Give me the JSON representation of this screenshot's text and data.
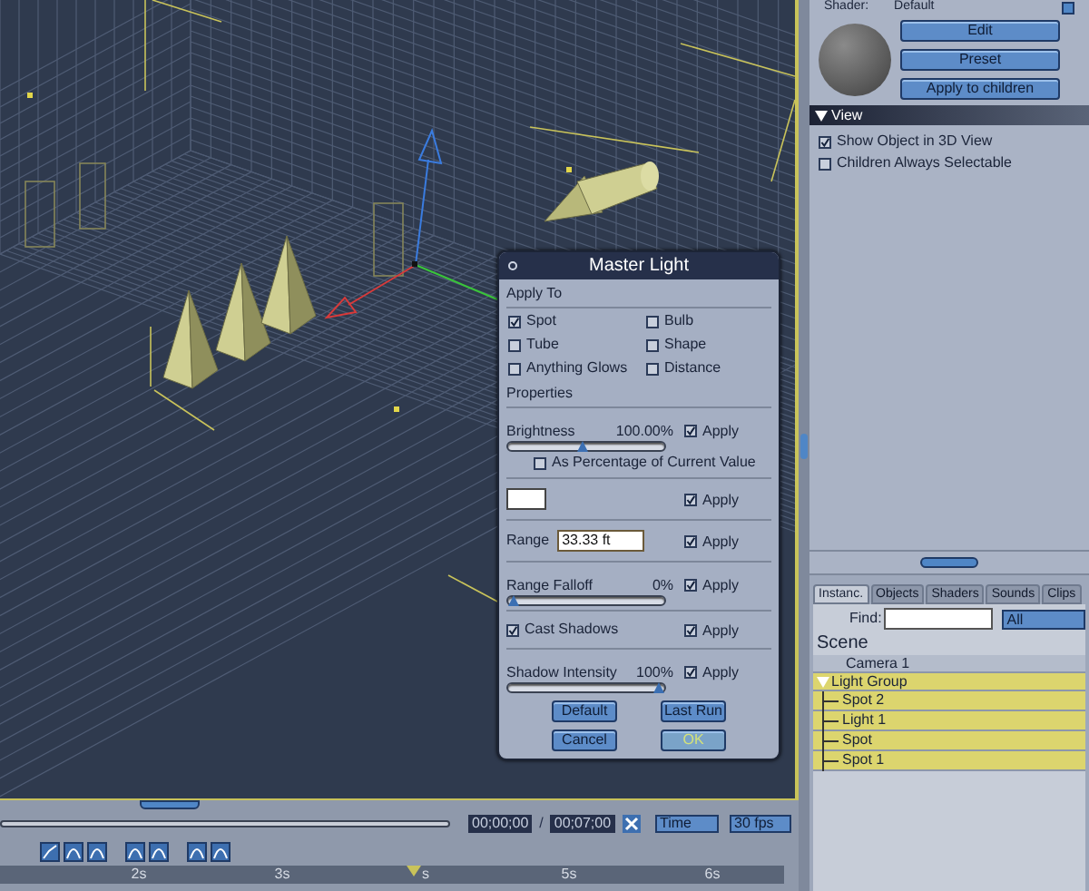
{
  "dialog": {
    "title": "Master Light",
    "apply_to": {
      "label": "Apply To",
      "options": [
        {
          "label": "Spot",
          "checked": true
        },
        {
          "label": "Bulb",
          "checked": false
        },
        {
          "label": "Tube",
          "checked": false
        },
        {
          "label": "Shape",
          "checked": false
        },
        {
          "label": "Anything Glows",
          "checked": false
        },
        {
          "label": "Distance",
          "checked": false
        }
      ]
    },
    "properties_label": "Properties",
    "properties": [
      {
        "kind": "slider",
        "label": "Brightness",
        "reading": "100.00%",
        "level": 0.48,
        "apply": {
          "label": "Apply",
          "checked": true
        },
        "option": {
          "label": "As Percentage of Current Value",
          "checked": false
        }
      },
      {
        "kind": "color",
        "color": "#ffffff",
        "apply": {
          "label": "Apply",
          "checked": true
        }
      },
      {
        "kind": "field",
        "label": "Range",
        "value": "33.33 ft",
        "apply": {
          "label": "Apply",
          "checked": true
        }
      },
      {
        "kind": "slider",
        "label": "Range Falloff",
        "reading": "0%",
        "level": 0,
        "apply": {
          "label": "Apply",
          "checked": true
        }
      },
      {
        "kind": "checkbox",
        "label": "Cast Shadows",
        "checked": true,
        "apply": {
          "label": "Apply",
          "checked": true
        }
      },
      {
        "kind": "slider",
        "label": "Shadow Intensity",
        "reading": "100%",
        "level": 1,
        "apply": {
          "label": "Apply",
          "checked": true
        }
      }
    ],
    "button_rows": [
      {
        "buttons": [
          {
            "label": "Default",
            "primary": false
          },
          {
            "label": "Last Run",
            "primary": false
          }
        ]
      },
      {
        "buttons": [
          {
            "label": "Cancel",
            "primary": false
          },
          {
            "label": "OK",
            "primary": true
          }
        ]
      }
    ]
  },
  "shader": {
    "label": "Shader:",
    "value": "Default",
    "buttons": [
      "Edit",
      "Preset",
      "Apply to children"
    ]
  },
  "view_section": {
    "title": "View",
    "expanded": true,
    "options": [
      {
        "label": "Show Object in 3D View",
        "checked": true
      },
      {
        "label": "Children Always Selectable",
        "checked": false
      }
    ]
  },
  "browser": {
    "tabs": [
      {
        "label": "Instanc.",
        "selected": true
      },
      {
        "label": "Objects",
        "selected": false
      },
      {
        "label": "Shaders",
        "selected": false
      },
      {
        "label": "Sounds",
        "selected": false
      },
      {
        "label": "Clips",
        "selected": false
      }
    ],
    "find": {
      "label": "Find:"
    },
    "filter": {
      "value": "All"
    },
    "scene": {
      "title": "Scene",
      "items": [
        {
          "label": "Camera 1",
          "selected": false
        },
        {
          "label": "Light Group",
          "selected": true,
          "expanded": true,
          "children": [
            {
              "label": "Spot 2",
              "selected": true
            },
            {
              "label": "Light 1",
              "selected": true
            },
            {
              "label": "Spot",
              "selected": true
            },
            {
              "label": "Spot 1",
              "selected": true
            }
          ]
        }
      ]
    }
  },
  "timeline": {
    "current_time": "00;00;00",
    "separator": "/",
    "duration": "00;07;00",
    "mode": "Time",
    "rate": "30 fps",
    "ruler": [
      "2s",
      "3s",
      "s",
      "5s",
      "6s"
    ]
  }
}
